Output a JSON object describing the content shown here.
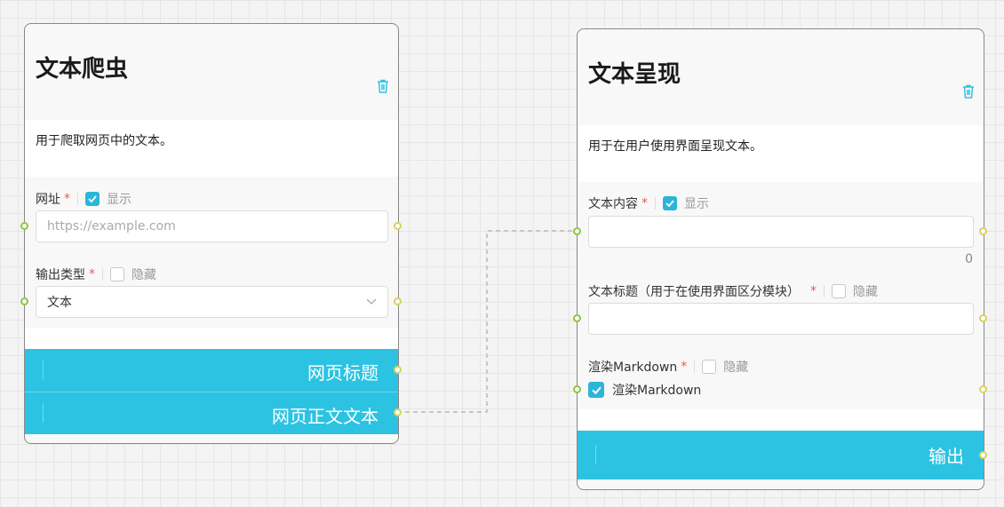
{
  "node_left": {
    "title": "文本爬虫",
    "description": "用于爬取网页中的文本。",
    "url_field": {
      "label": "网址",
      "required_mark": "*",
      "toggle_label": "显示",
      "toggle_checked": true,
      "placeholder": "https://example.com"
    },
    "type_field": {
      "label": "输出类型",
      "required_mark": "*",
      "toggle_label": "隐藏",
      "toggle_checked": false,
      "value": "文本"
    },
    "outputs": [
      {
        "label": "网页标题"
      },
      {
        "label": "网页正文文本"
      }
    ]
  },
  "node_right": {
    "title": "文本呈现",
    "description": "用于在用户使用界面呈现文本。",
    "content_field": {
      "label": "文本内容",
      "required_mark": "*",
      "toggle_label": "显示",
      "toggle_checked": true,
      "char_count": "0"
    },
    "title_field": {
      "label": "文本标题（用于在使用界面区分模块）",
      "required_mark": "*",
      "toggle_label": "隐藏",
      "toggle_checked": false
    },
    "markdown_field": {
      "label": "渲染Markdown",
      "required_mark": "*",
      "toggle_label": "隐藏",
      "toggle_checked": false,
      "checkbox_label": "渲染Markdown",
      "checkbox_checked": true
    },
    "outputs": [
      {
        "label": "输出"
      }
    ]
  },
  "colors": {
    "accent": "#2cc3e2",
    "input_port": "#8cc63f",
    "output_port": "#d9d35a",
    "required": "#e85a5a"
  }
}
